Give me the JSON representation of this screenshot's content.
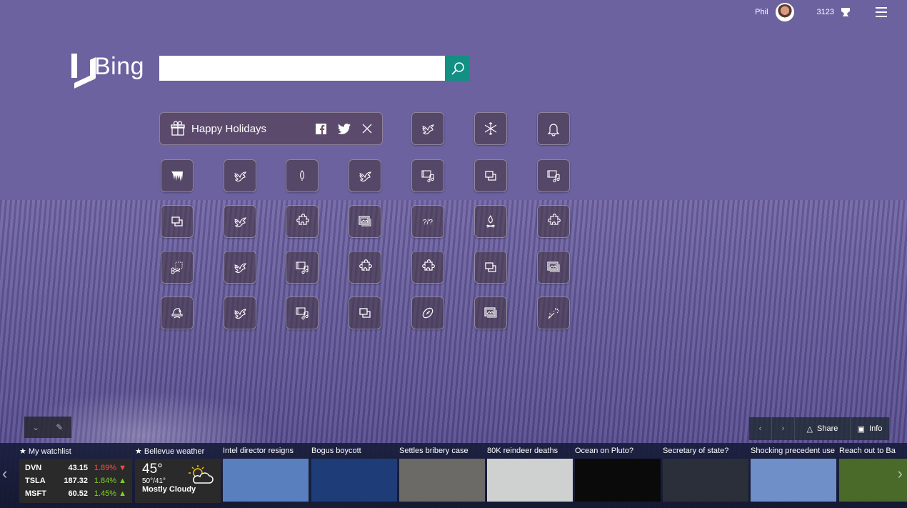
{
  "user": {
    "name": "Phil",
    "points": "3123"
  },
  "logo": {
    "text": "Bing"
  },
  "search": {
    "value": "",
    "placeholder": ""
  },
  "banner": {
    "title": "Happy Holidays",
    "share_facebook": "facebook-share",
    "share_twitter": "twitter-share"
  },
  "tiles": [
    [
      "dove",
      "snowflake",
      "bell"
    ],
    [
      "icicles",
      "dove",
      "light-bulb",
      "dove",
      "video-music",
      "stacked-windows",
      "video-music"
    ],
    [
      "stacked-windows",
      "dove",
      "puzzle",
      "photo-gallery",
      "question-marks",
      "campfire",
      "puzzle"
    ],
    [
      "snip-scissors",
      "dove",
      "video-music",
      "puzzle",
      "puzzle",
      "stacked-windows",
      "photo-gallery"
    ],
    [
      "santa-hat",
      "dove",
      "video-music",
      "stacked-windows",
      "football",
      "photo-gallery",
      "fireworks"
    ]
  ],
  "image_controls": {
    "share": "Share",
    "info": "Info"
  },
  "watchlist": {
    "title": "My watchlist",
    "rows": [
      {
        "symbol": "DVN",
        "price": "43.15",
        "change": "1.89%",
        "dir": "down"
      },
      {
        "symbol": "TSLA",
        "price": "187.32",
        "change": "1.84%",
        "dir": "up"
      },
      {
        "symbol": "MSFT",
        "price": "60.52",
        "change": "1.45%",
        "dir": "up"
      }
    ]
  },
  "weather": {
    "title": "Bellevue weather",
    "temp": "45°",
    "hilo": "50°/41°",
    "desc": "Mostly Cloudy"
  },
  "news": [
    {
      "title": "Intel director resigns",
      "bg": "#5a7fbf"
    },
    {
      "title": "Bogus boycott",
      "bg": "#1d3c78"
    },
    {
      "title": "Settles bribery case",
      "bg": "#6b6a66"
    },
    {
      "title": "80K reindeer deaths",
      "bg": "#cfd0d0"
    },
    {
      "title": "Ocean on Pluto?",
      "bg": "#0a0a0a"
    },
    {
      "title": "Secretary of state?",
      "bg": "#2b2f3a"
    },
    {
      "title": "Shocking precedent use",
      "bg": "#6f8fc8"
    },
    {
      "title": "Reach out to Ba",
      "bg": "#4a6a2a"
    }
  ]
}
